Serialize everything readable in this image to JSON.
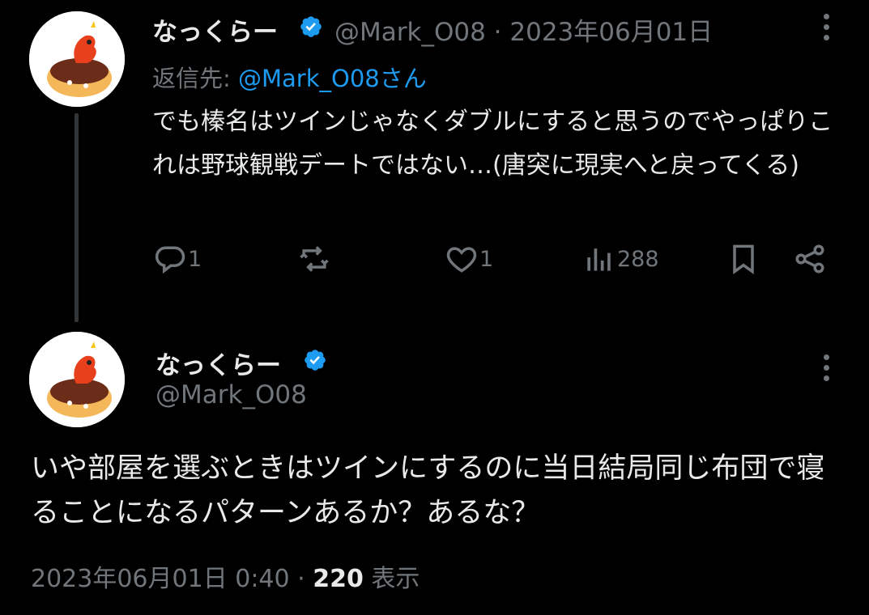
{
  "colors": {
    "background": "#000000",
    "text": "#e7e9ea",
    "muted": "#71767b",
    "link": "#1d9bf0",
    "verified": "#1d9bf0"
  },
  "reply_tweet": {
    "display_name": "なっくらー",
    "handle": "@Mark_O08",
    "separator": "·",
    "date": "2023年06月01日",
    "reply_label": "返信先:",
    "reply_to": "@Mark_O08さん",
    "text": "でも榛名はツインじゃなくダブルにすると思うのでやっぱりこれは野球観戦デートではない…(唐突に現実へと戻ってくる)",
    "actions": {
      "reply_count": "1",
      "retweet_count": "",
      "like_count": "1",
      "view_count": "288"
    },
    "icons": [
      "reply-icon",
      "retweet-icon",
      "like-icon",
      "views-icon",
      "bookmark-icon",
      "share-icon",
      "more-icon",
      "verified-badge-icon"
    ]
  },
  "main_tweet": {
    "display_name": "なっくらー",
    "handle": "@Mark_O08",
    "text": "いや部屋を選ぶときはツインにするのに当日結局同じ布団で寝ることになるパターンあるか？あるな？",
    "timestamp": "2023年06月01日 0:40",
    "separator": "·",
    "views": "220",
    "views_label": "表示"
  }
}
